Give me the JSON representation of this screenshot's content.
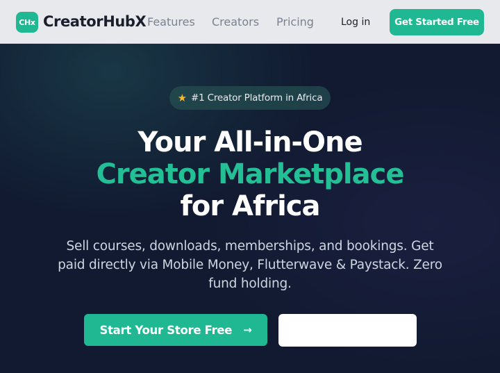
{
  "nav": {
    "logo_badge": "CHx",
    "brand": "CreatorHubX",
    "links": [
      "Features",
      "Creators",
      "Pricing"
    ],
    "login": "Log in",
    "cta": "Get Started Free"
  },
  "hero": {
    "badge_icon": "star-icon",
    "badge_text": "#1 Creator Platform in Africa",
    "headline_1": "Your All-in-One",
    "headline_2": "Creator Marketplace",
    "headline_3": "for Africa",
    "subtitle": "Sell courses, downloads, memberships, and bookings. Get paid directly via Mobile Money, Flutterwave & Paystack. Zero fund holding.",
    "primary_button": "Start Your Store Free",
    "primary_button_icon": "arrow-right-icon",
    "secondary_button": ""
  },
  "colors": {
    "accent": "#1fb893",
    "hero_bg": "#111a30",
    "nav_bg": "#e7e9ed"
  }
}
